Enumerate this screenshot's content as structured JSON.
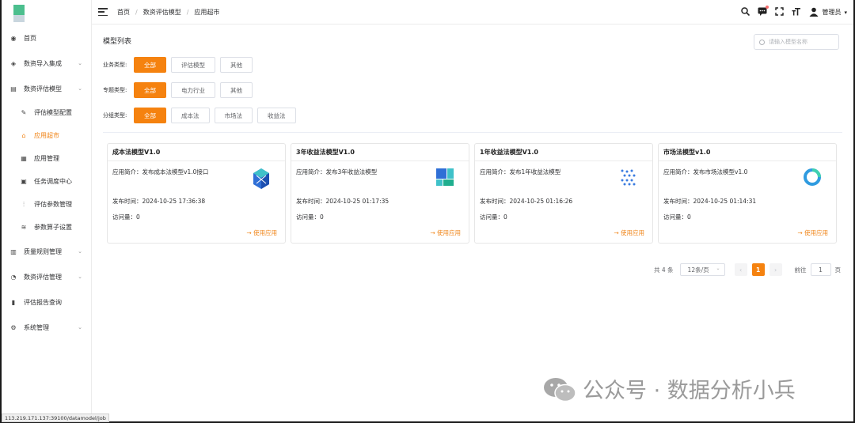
{
  "sidebar": {
    "items": [
      {
        "label": "首页",
        "icon": "dashboard-icon",
        "chevron": false,
        "sub": false,
        "active": false
      },
      {
        "label": "数资导入集成",
        "icon": "layers-icon",
        "chevron": true,
        "sub": false,
        "active": false
      },
      {
        "label": "数资评估模型",
        "icon": "document-icon",
        "chevron": true,
        "sub": false,
        "active": false
      },
      {
        "label": "评估模型配置",
        "icon": "file-edit-icon",
        "chevron": false,
        "sub": true,
        "active": false
      },
      {
        "label": "应用超市",
        "icon": "shop-icon",
        "chevron": false,
        "sub": true,
        "active": true
      },
      {
        "label": "应用管理",
        "icon": "grid-icon",
        "chevron": false,
        "sub": true,
        "active": false
      },
      {
        "label": "任务调度中心",
        "icon": "calendar-icon",
        "chevron": false,
        "sub": true,
        "active": false
      },
      {
        "label": "评估参数管理",
        "icon": "sliders-icon",
        "chevron": false,
        "sub": true,
        "active": false
      },
      {
        "label": "参数算子设置",
        "icon": "stack-icon",
        "chevron": false,
        "sub": true,
        "active": false
      },
      {
        "label": "质量规则管理",
        "icon": "table-icon",
        "chevron": true,
        "sub": false,
        "active": false
      },
      {
        "label": "数资评估管理",
        "icon": "pie-icon",
        "chevron": true,
        "sub": false,
        "active": false
      },
      {
        "label": "评估报告查询",
        "icon": "bar-chart-icon",
        "chevron": false,
        "sub": false,
        "active": false
      },
      {
        "label": "系统管理",
        "icon": "gear-icon",
        "chevron": true,
        "sub": false,
        "active": false
      }
    ]
  },
  "breadcrumb": [
    "首页",
    "数资评估模型",
    "应用超市"
  ],
  "header": {
    "user": "管理员"
  },
  "main": {
    "title": "模型列表",
    "search_placeholder": "请输入模型名称"
  },
  "filters": [
    {
      "label": "业务类型:",
      "options": [
        "全部",
        "评估模型",
        "其他"
      ],
      "selected": 0
    },
    {
      "label": "专题类型:",
      "options": [
        "全部",
        "电力行业",
        "其他"
      ],
      "selected": 0
    },
    {
      "label": "分组类型:",
      "options": [
        "全部",
        "成本法",
        "市场法",
        "收益法"
      ],
      "selected": 0
    }
  ],
  "cards": [
    {
      "title": "成本法模型V1.0",
      "desc": "应用简介：发布成本法模型v1.0接口",
      "time": "发布时间：2024-10-25 17:36:38",
      "visits": "访问量：0",
      "action": "使用应用",
      "icon": "cube-icon"
    },
    {
      "title": "3年收益法模型V1.0",
      "desc": "应用简介：发布3年收益法模型",
      "time": "发布时间：2024-10-25 01:17:35",
      "visits": "访问量：0",
      "action": "使用应用",
      "icon": "blocks-icon"
    },
    {
      "title": "1年收益法模型V1.0",
      "desc": "应用简介：发布1年收益法模型",
      "time": "发布时间：2024-10-25 01:16:26",
      "visits": "访问量：0",
      "action": "使用应用",
      "icon": "dots-icon"
    },
    {
      "title": "市场法模型v1.0",
      "desc": "应用简介：发布市场法模型v1.0",
      "time": "发布时间：2024-10-25 01:14:31",
      "visits": "访问量：0",
      "action": "使用应用",
      "icon": "ring-icon"
    }
  ],
  "pagination": {
    "total": "共 4 条",
    "page_size": "12条/页",
    "current": "1",
    "goto_label": "前往",
    "goto_value": "1",
    "page_unit": "页"
  },
  "status_url": "113.219.171.137:39100/datamodel/job",
  "watermark": "管理员",
  "badge": "公众号 · 数据分析小兵",
  "colors": {
    "accent": "#f5820f",
    "logo_green": "#4cbf8e"
  }
}
